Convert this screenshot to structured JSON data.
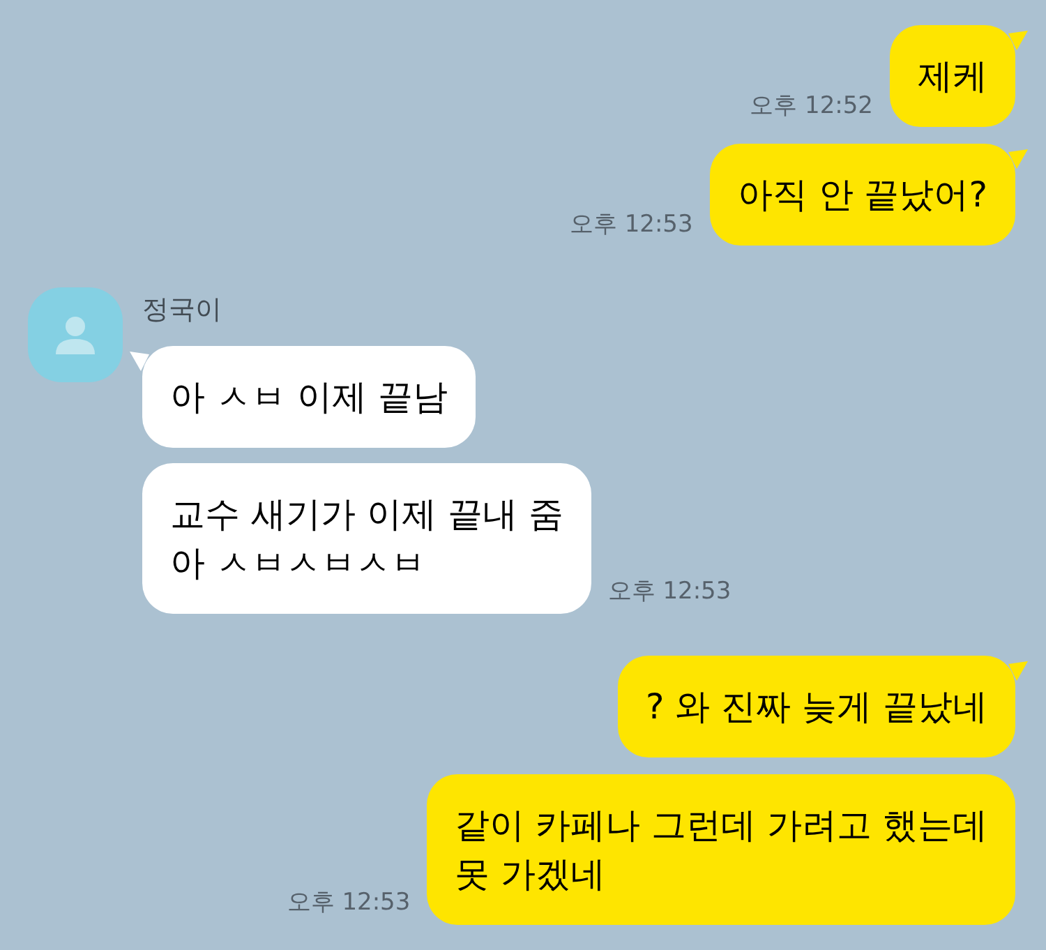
{
  "groups": [
    {
      "kind": "me",
      "messages": [
        {
          "text": "제케",
          "time": "오후 12:52",
          "tail": true
        },
        {
          "text": "아직 안 끝났어?",
          "time": "오후 12:53",
          "tail": true
        }
      ]
    },
    {
      "kind": "other",
      "sender": "정국이",
      "messages": [
        {
          "text": "아 ㅅㅂ 이제 끝남",
          "tail": true
        },
        {
          "text": "교수 새기가 이제 끝내 줌\n아 ㅅㅂㅅㅂㅅㅂ",
          "time": "오후 12:53",
          "tail": false
        }
      ]
    },
    {
      "kind": "me",
      "messages": [
        {
          "text": "? 와 진짜 늦게 끝났네",
          "tail": true
        },
        {
          "text": "같이 카페나 그런데 가려고 했는데\n못 가겠네",
          "time": "오후 12:53",
          "tail": false
        }
      ]
    }
  ]
}
